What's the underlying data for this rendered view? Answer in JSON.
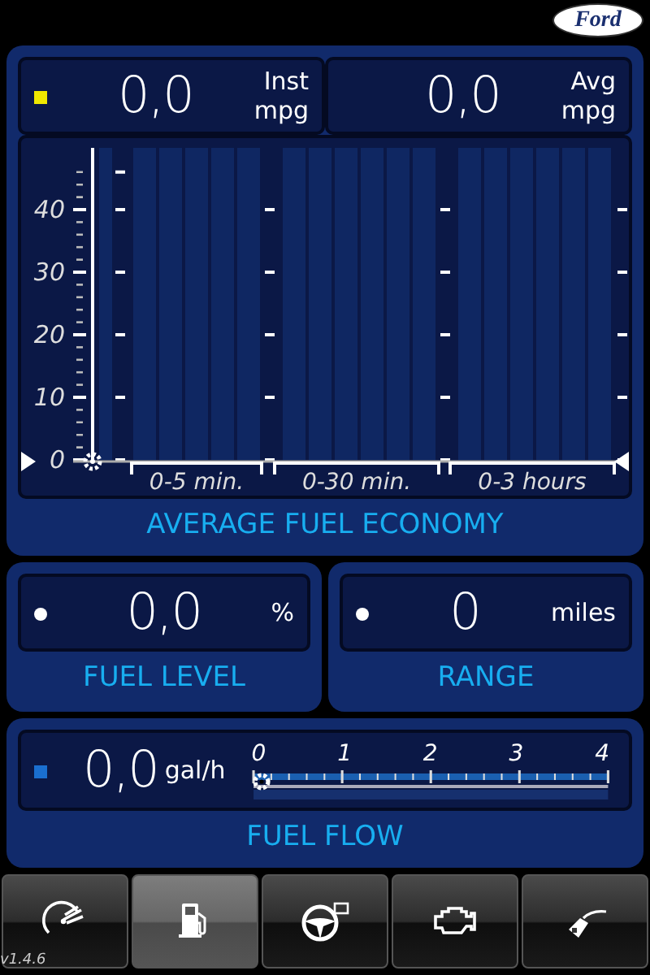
{
  "logo": "Ford",
  "economy": {
    "readouts": [
      {
        "value": "0,0",
        "name": "Inst",
        "unit": "mpg",
        "kind": "square",
        "color": "#f0e800"
      },
      {
        "value": "0,0",
        "name": "Avg",
        "unit": "mpg"
      }
    ],
    "y_labels": [
      "40",
      "30",
      "20",
      "10",
      "0"
    ],
    "periods": [
      "0-5 min.",
      "0-30 min.",
      "0-3 hours"
    ],
    "title": "AVERAGE FUEL ECONOMY"
  },
  "panels": [
    {
      "value": "0,0",
      "unit": "%",
      "title": "FUEL LEVEL",
      "kind": "dot",
      "color": "#ffffff"
    },
    {
      "value": "0",
      "unit": "miles",
      "title": "RANGE",
      "kind": "dot",
      "color": "#ffffff"
    }
  ],
  "fuel_flow": {
    "value": "0,0",
    "unit": "gal/h",
    "kind": "square",
    "color": "#1a6fd0",
    "scale": [
      "0",
      "1",
      "2",
      "3",
      "4"
    ],
    "title": "FUEL FLOW"
  },
  "tabs": [
    {
      "kind": "gauge",
      "selected": false
    },
    {
      "kind": "fuel-pump",
      "selected": true
    },
    {
      "kind": "steering-wheel",
      "selected": false
    },
    {
      "kind": "engine",
      "selected": false
    },
    {
      "kind": "nozzle",
      "selected": false
    }
  ],
  "version": "v1.4.6"
}
